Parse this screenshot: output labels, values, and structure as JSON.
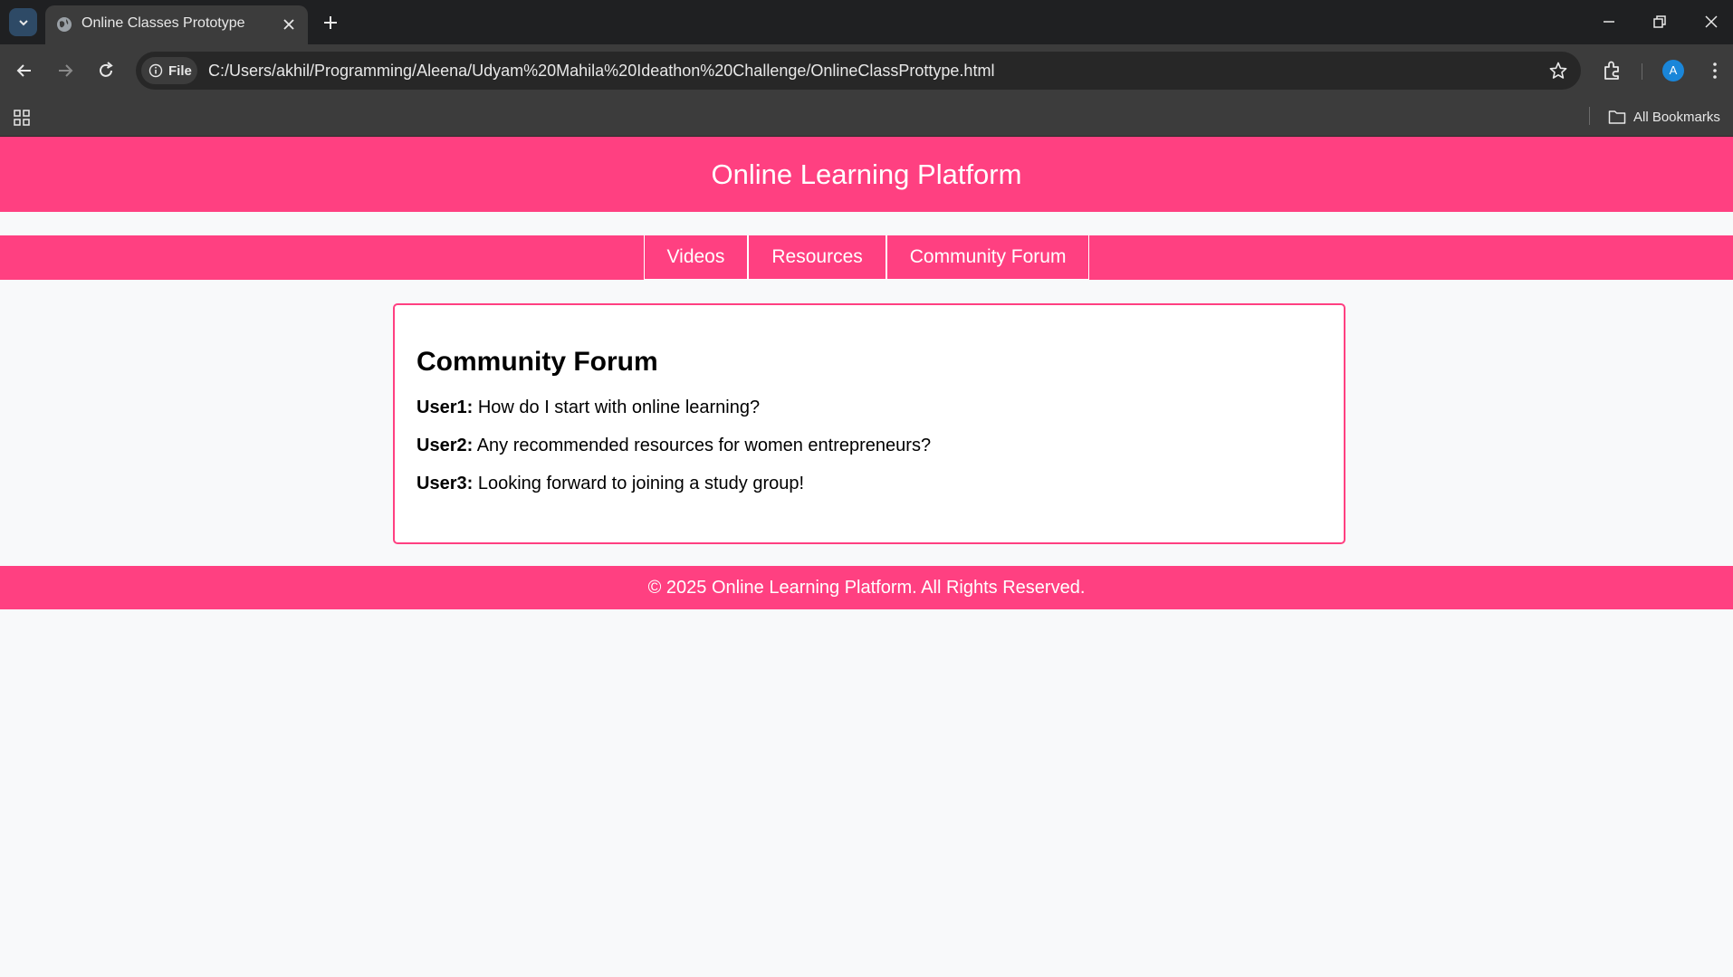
{
  "browser": {
    "tab_title": "Online Classes Prototype",
    "site_chip": "File",
    "url": "C:/Users/akhil/Programming/Aleena/Udyam%20Mahila%20Ideathon%20Challenge/OnlineClassProttype.html",
    "profile_initial": "A",
    "bookmarks_label": "All Bookmarks",
    "icons": [
      "tab-search-icon",
      "globe-icon",
      "close-icon",
      "plus-icon",
      "minimize-icon",
      "restore-icon",
      "window-close-icon",
      "back-arrow-icon",
      "forward-arrow-icon",
      "reload-icon",
      "info-icon",
      "star-icon",
      "extensions-icon",
      "kebab-menu-icon",
      "apps-grid-icon",
      "folder-icon"
    ]
  },
  "site": {
    "header_title": "Online Learning Platform",
    "nav": [
      {
        "label": "Videos"
      },
      {
        "label": "Resources"
      },
      {
        "label": "Community Forum"
      }
    ],
    "section_title": "Community Forum",
    "posts": [
      {
        "user": "User1:",
        "text": " How do I start with online learning?"
      },
      {
        "user": "User2:",
        "text": " Any recommended resources for women entrepreneurs?"
      },
      {
        "user": "User3:",
        "text": " Looking forward to joining a study group!"
      }
    ],
    "footer": "© 2025 Online Learning Platform. All Rights Reserved."
  },
  "colors": {
    "brand_pink": "#ff4081",
    "page_bg": "#f8f9fa",
    "chrome_dark": "#1f2022",
    "chrome_toolbar": "#3c3c3c",
    "avatar_blue": "#1a86d9"
  }
}
